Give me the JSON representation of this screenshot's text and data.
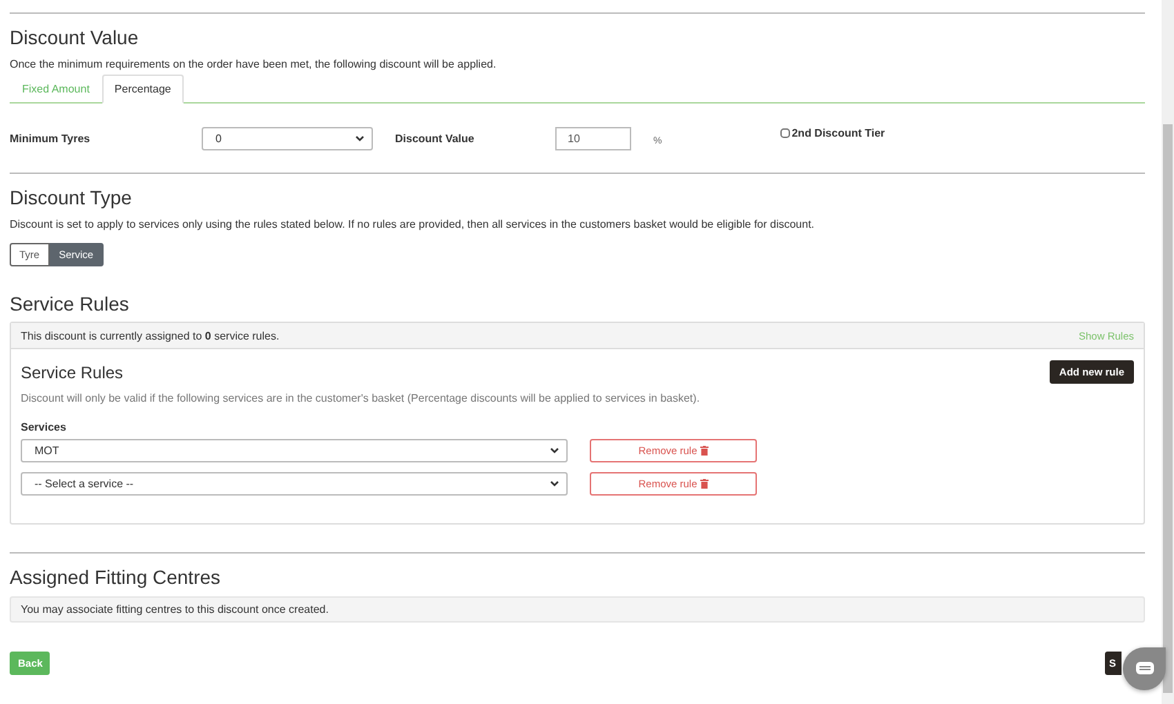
{
  "discount_value": {
    "title": "Discount Value",
    "description": "Once the minimum requirements on the order have been met, the following discount will be applied.",
    "tabs": [
      {
        "label": "Fixed Amount",
        "selected": false
      },
      {
        "label": "Percentage",
        "selected": true
      }
    ],
    "minimum_tyres": {
      "label": "Minimum Tyres",
      "value": "0"
    },
    "discount_value_field": {
      "label": "Discount Value",
      "value": "10",
      "unit": "%"
    },
    "second_tier": {
      "label": "2nd Discount Tier",
      "checked": false
    }
  },
  "discount_type": {
    "title": "Discount Type",
    "description": "Discount is set to apply to services only using the rules stated below. If no rules are provided, then all services in the customers basket would be eligible for discount.",
    "options": [
      {
        "label": "Tyre",
        "selected": false
      },
      {
        "label": "Service",
        "selected": true
      }
    ]
  },
  "service_rules": {
    "title": "Service Rules",
    "summary": "This discount is currently assigned to **0** service rules.",
    "show_rules": "Show Rules",
    "panel_title": "Service Rules",
    "add_button": "Add new rule",
    "description": "Discount will only be valid if the following services are in the customer's basket (Percentage discounts will be applied to services in basket).",
    "services_label": "Services",
    "rules": [
      {
        "value": "MOT",
        "remove": "Remove rule"
      },
      {
        "value": "-- Select a service --",
        "remove": "Remove rule"
      }
    ]
  },
  "fitting_centres": {
    "title": "Assigned Fitting Centres",
    "message": "You may associate fitting centres to this discount once created."
  },
  "buttons": {
    "back": "Back",
    "save": "S"
  }
}
